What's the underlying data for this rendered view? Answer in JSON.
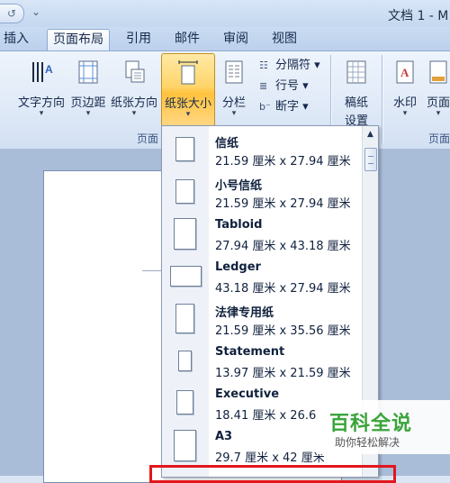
{
  "titlebar": {
    "window_title": "文档 1 - M",
    "undo_icon": "↺",
    "customize_icon": "⌄"
  },
  "tabs": [
    {
      "label": "插入",
      "active": false
    },
    {
      "label": "页面布局",
      "active": true
    },
    {
      "label": "引用",
      "active": false
    },
    {
      "label": "邮件",
      "active": false
    },
    {
      "label": "审阅",
      "active": false
    },
    {
      "label": "视图",
      "active": false
    }
  ],
  "ribbon": {
    "text_direction": "文字方向",
    "margins": "页边距",
    "orientation": "纸张方向",
    "size": "纸张大小",
    "columns": "分栏",
    "breaks": "分隔符",
    "line_numbers": "行号",
    "hyphenation": "断字",
    "manuscript_line1": "稿纸",
    "manuscript_line2": "设置",
    "watermark": "水印",
    "page_color": "页面",
    "group_page_setup": "页面",
    "group_page_background": "页面",
    "dropdown_arrow": "▾"
  },
  "paper_sizes": [
    {
      "name": "信纸",
      "dims": "21.59 厘米 x 27.94 厘米"
    },
    {
      "name": "小号信纸",
      "dims": "21.59 厘米 x 27.94 厘米"
    },
    {
      "name": "Tabloid",
      "dims": "27.94 厘米 x 43.18 厘米"
    },
    {
      "name": "Ledger",
      "dims": "43.18 厘米 x 27.94 厘米"
    },
    {
      "name": "法律专用纸",
      "dims": "21.59 厘米 x 35.56 厘米"
    },
    {
      "name": "Statement",
      "dims": "13.97 厘米 x 21.59 厘米"
    },
    {
      "name": "Executive",
      "dims": "18.41 厘米 x 26.6"
    },
    {
      "name": "A3",
      "dims": "29.7 厘米 x 42 厘米"
    }
  ],
  "scrollbar": {
    "up_arrow": "▲"
  },
  "watermark": {
    "main": "百科全说",
    "sub": "助你轻松解决"
  },
  "colors": {
    "highlight": "#e2161d",
    "active_button": "#ffd56a",
    "watermark_green": "#3aa43a"
  }
}
